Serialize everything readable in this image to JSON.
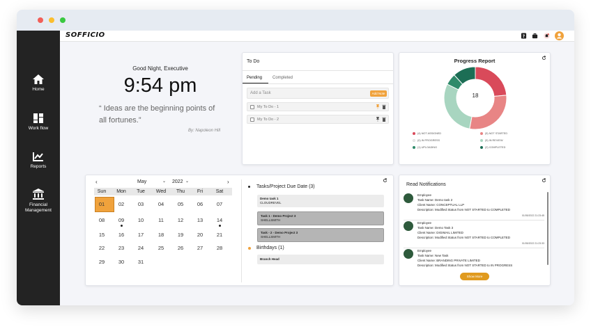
{
  "app": {
    "logo": "SOFFICIO"
  },
  "sidebar": {
    "items": [
      {
        "label": "Home",
        "icon": "home-icon"
      },
      {
        "label": "Work flow",
        "icon": "workflow-icon"
      },
      {
        "label": "Reports",
        "icon": "reports-icon"
      },
      {
        "label": "Financial",
        "label2": "Management",
        "icon": "bank-icon"
      }
    ]
  },
  "greeting": {
    "salutation": "Good Night, Executive",
    "time": "9:54 pm",
    "quote_line1": "“ Ideas are the beginning points of",
    "quote_line2": "all fortunes.”",
    "author": "By: Napoleon Hill"
  },
  "todo": {
    "title": "To Do",
    "tabs": [
      "Pending",
      "Completed"
    ],
    "add_placeholder": "Add a Task",
    "add_button": "Add Note",
    "items": [
      "My To Do - 1",
      "My To Do - 2"
    ]
  },
  "progress": {
    "title": "Progress Report",
    "center_value": "18",
    "legend": [
      {
        "label": "(4)  NOT ASSIGNED",
        "color": "#d94a5a"
      },
      {
        "label": "(5)  NOT STARTED",
        "color": "#e88585"
      },
      {
        "label": "(0)  IN PROGRESS",
        "color": "#efefef"
      },
      {
        "label": "(5)  IN REVIEW",
        "color": "#a8d5c0"
      },
      {
        "label": "(1)  UPLOADING",
        "color": "#2f8a6a"
      },
      {
        "label": "(2)  COMPLETED",
        "color": "#1c6e55"
      }
    ]
  },
  "calendar": {
    "month": "May",
    "year": "2022",
    "weekdays": [
      "Sun",
      "Mon",
      "Tue",
      "Wed",
      "Thu",
      "Fri",
      "Sat"
    ],
    "weeks": [
      [
        "01",
        "02",
        "03",
        "04",
        "05",
        "06",
        "07"
      ],
      [
        "08",
        "09",
        "10",
        "11",
        "12",
        "13",
        "14"
      ],
      [
        "15",
        "16",
        "17",
        "18",
        "19",
        "20",
        "21"
      ],
      [
        "22",
        "23",
        "24",
        "25",
        "26",
        "27",
        "28"
      ],
      [
        "29",
        "30",
        "31",
        "",
        "",
        "",
        ""
      ]
    ],
    "selected": "01",
    "event_days": [
      "09",
      "14"
    ]
  },
  "due": {
    "section1": "Tasks/Project Due Date (3)",
    "tasks": [
      {
        "name": "Demo task 1",
        "client": "CLOUDREVEL"
      },
      {
        "name": "Task 1 - Demo Project 3",
        "client": "SHELLSMITH"
      },
      {
        "name": "Task - 2 - Demo Project 3",
        "client": "SHELLSMITH"
      }
    ],
    "section2": "Birthdays (1)",
    "birthdays": [
      {
        "name": "Branch Head"
      }
    ]
  },
  "notifications": {
    "title": "Read Notifications",
    "show_more": "Show More",
    "items": [
      {
        "role": "Employee",
        "task": "Task Name: Demo task 2",
        "client": "Client Name: CONCEPTUAL LLP",
        "desc": "Description: Modified Status from NOT STARTED to COMPLETED",
        "time": "01/05/2022 21:23:45"
      },
      {
        "role": "Employee",
        "task": "Task Name: Demo Task 3",
        "client": "Client Name: DIGIMAIL LIMITED",
        "desc": "Description: Modified Status from NOT STARTED to COMPLETED",
        "time": "01/05/2022 21:23:33"
      },
      {
        "role": "Employee",
        "task": "Task Name: New Task",
        "client": "Client Name: BRANDING PRIVATE LIMITED",
        "desc": "Description: Modified Status from NOT STARTED to IN PROGRESS",
        "time": ""
      }
    ]
  },
  "chart_data": {
    "type": "pie",
    "title": "Progress Report",
    "categories": [
      "NOT ASSIGNED",
      "NOT STARTED",
      "IN PROGRESS",
      "IN REVIEW",
      "UPLOADING",
      "COMPLETED"
    ],
    "values": [
      4,
      5,
      0,
      5,
      1,
      2
    ],
    "colors": [
      "#d94a5a",
      "#e88585",
      "#efefef",
      "#a8d5c0",
      "#2f8a6a",
      "#1c6e55"
    ],
    "center_label": "18",
    "legend_position": "bottom"
  }
}
